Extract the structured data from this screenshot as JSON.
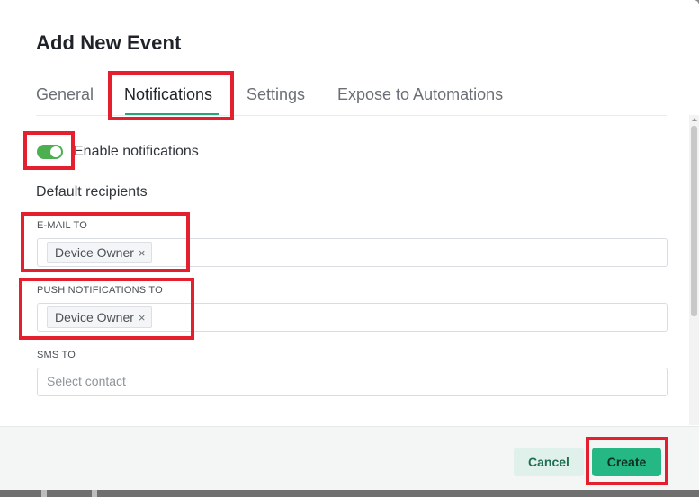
{
  "dialog": {
    "title": "Add New Event"
  },
  "tabs": [
    {
      "label": "General",
      "active": false
    },
    {
      "label": "Notifications",
      "active": true
    },
    {
      "label": "Settings",
      "active": false
    },
    {
      "label": "Expose to Automations",
      "active": false
    }
  ],
  "notifications": {
    "enabled": true,
    "toggle_label": "Enable notifications",
    "section_heading": "Default recipients",
    "fields": [
      {
        "label": "E-MAIL TO",
        "chips": [
          "Device Owner"
        ],
        "placeholder": ""
      },
      {
        "label": "PUSH NOTIFICATIONS TO",
        "chips": [
          "Device Owner"
        ],
        "placeholder": ""
      },
      {
        "label": "SMS TO",
        "chips": [],
        "placeholder": "Select contact"
      }
    ]
  },
  "footer": {
    "cancel_label": "Cancel",
    "create_label": "Create"
  },
  "icons": {
    "chip_remove": "close-icon"
  },
  "colors": {
    "accent": "#25b784",
    "tab_underline": "#2aa27b",
    "toggle_on": "#4caf50",
    "highlight": "#e5202e",
    "cancel_bg": "#dff1ea"
  }
}
